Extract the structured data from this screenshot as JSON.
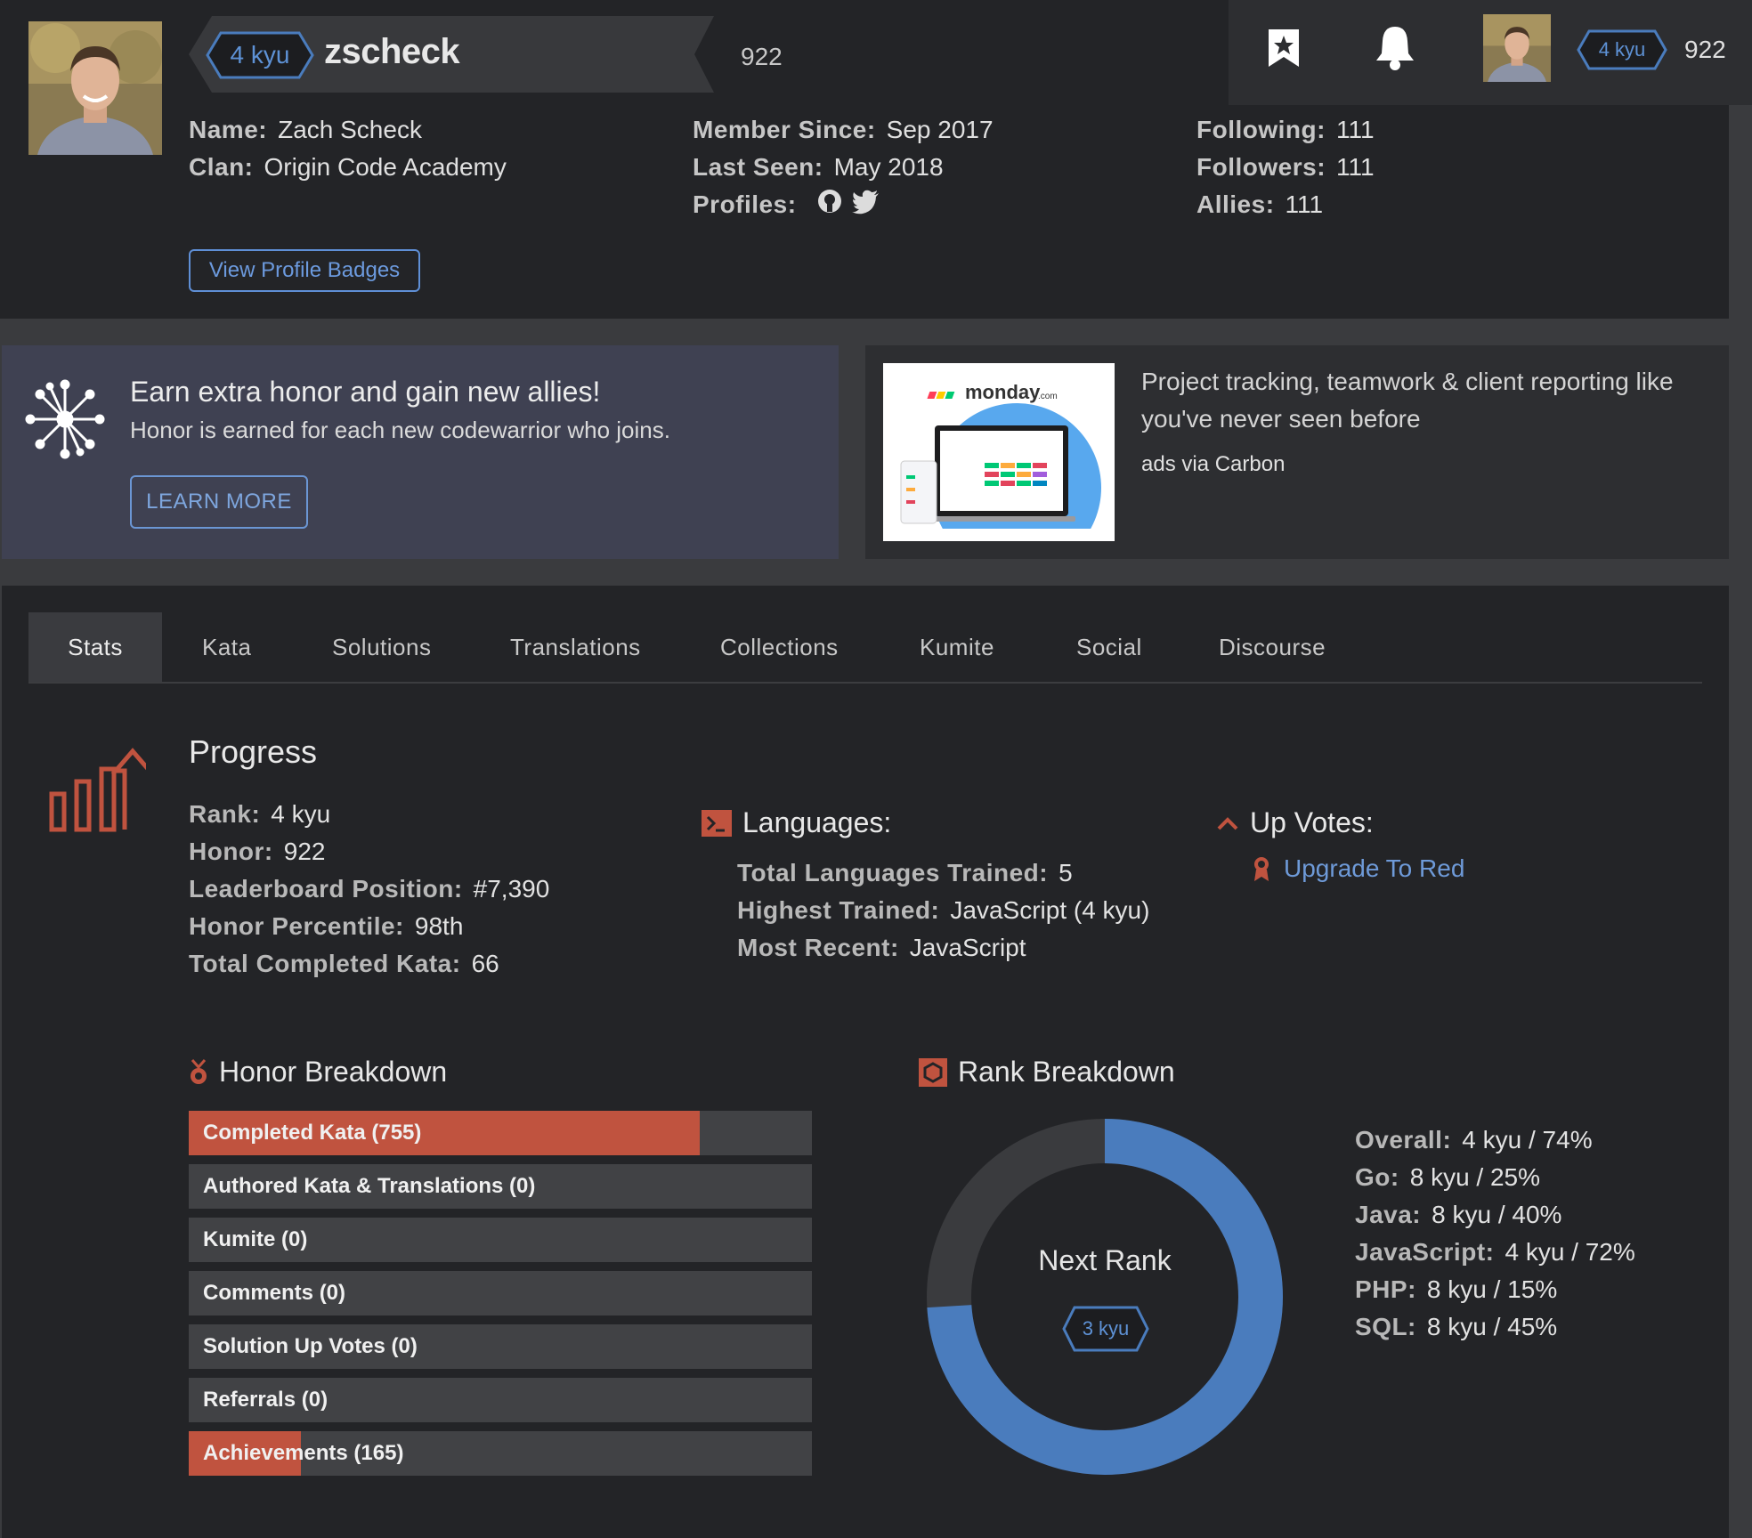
{
  "user": {
    "username": "zscheck",
    "rank": "4 kyu",
    "honor": "922",
    "name": "Zach Scheck",
    "clan": "Origin Code Academy",
    "member_since": "Sep 2017",
    "last_seen": "May 2018",
    "following": "111",
    "followers": "111",
    "allies": "111"
  },
  "labels": {
    "name": "Name:",
    "clan": "Clan:",
    "member_since": "Member Since:",
    "last_seen": "Last Seen:",
    "profiles": "Profiles:",
    "following": "Following:",
    "followers": "Followers:",
    "allies": "Allies:"
  },
  "profile_icons": [
    "github-icon",
    "twitter-icon"
  ],
  "view_badges_button": "View Profile Badges",
  "topnav": {
    "icons": [
      "bookmark-icon",
      "bell-icon"
    ],
    "rank": "4 kyu",
    "honor": "922"
  },
  "referral": {
    "title": "Earn extra honor and gain new allies!",
    "subtitle": "Honor is earned for each new codewarrior who joins.",
    "button": "LEARN MORE"
  },
  "ad": {
    "brand": "monday",
    "brand_suffix": ".com",
    "text": "Project tracking, teamwork & client reporting like you've never seen before",
    "via": "ads via Carbon"
  },
  "tabs": [
    "Stats",
    "Kata",
    "Solutions",
    "Translations",
    "Collections",
    "Kumite",
    "Social",
    "Discourse"
  ],
  "active_tab": "Stats",
  "progress": {
    "title": "Progress",
    "items": [
      {
        "label": "Rank:",
        "value": "4 kyu"
      },
      {
        "label": "Honor:",
        "value": "922"
      },
      {
        "label": "Leaderboard Position:",
        "value": "#7,390"
      },
      {
        "label": "Honor Percentile:",
        "value": "98th"
      },
      {
        "label": "Total Completed Kata:",
        "value": "66"
      }
    ]
  },
  "languages": {
    "title": "Languages:",
    "items": [
      {
        "label": "Total Languages Trained:",
        "value": "5"
      },
      {
        "label": "Highest Trained:",
        "value": "JavaScript (4 kyu)"
      },
      {
        "label": "Most Recent:",
        "value": "JavaScript"
      }
    ]
  },
  "upvotes": {
    "title": "Up Votes:",
    "link": "Upgrade To Red"
  },
  "honor_breakdown": {
    "title": "Honor Breakdown",
    "bars": [
      {
        "label": "Completed Kata (755)",
        "fill": 0.82
      },
      {
        "label": "Authored Kata & Translations (0)",
        "fill": 0
      },
      {
        "label": "Kumite (0)",
        "fill": 0
      },
      {
        "label": "Comments (0)",
        "fill": 0
      },
      {
        "label": "Solution Up Votes (0)",
        "fill": 0
      },
      {
        "label": "Referrals (0)",
        "fill": 0
      },
      {
        "label": "Achievements (165)",
        "fill": 0.18
      }
    ]
  },
  "rank_breakdown": {
    "title": "Rank Breakdown",
    "center_label": "Next Rank",
    "next_rank": "3 kyu",
    "progress": 0.74,
    "items": [
      {
        "label": "Overall:",
        "value": "4 kyu / 74%"
      },
      {
        "label": "Go:",
        "value": "8 kyu / 25%"
      },
      {
        "label": "Java:",
        "value": "8 kyu / 40%"
      },
      {
        "label": "JavaScript:",
        "value": "4 kyu / 72%"
      },
      {
        "label": "PHP:",
        "value": "8 kyu / 15%"
      },
      {
        "label": "SQL:",
        "value": "8 kyu / 45%"
      }
    ]
  },
  "colors": {
    "accent_blue": "#4a7cbd",
    "accent_red": "#c0533f",
    "panel_bg": "#232427"
  }
}
